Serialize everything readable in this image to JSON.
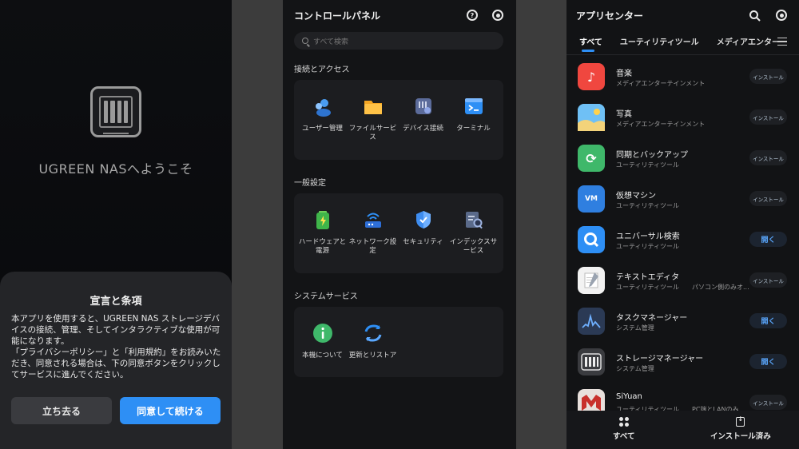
{
  "welcome_panel": {
    "welcome_text": "UGREEN NASへようこそ",
    "terms_title": "宣言と条項",
    "terms_paragraphs": [
      "本アプリを使用すると、UGREEN NAS ストレージデバイスの接続、管理、そしてインタラクティブな使用が可能になります。",
      "「プライバシーポリシー」と「利用規約」をお読みいただき、同意される場合は、下の同意ボタンをクリックしてサービスに進んでください。"
    ],
    "leave_button": "立ち去る",
    "agree_button": "同意して続ける"
  },
  "control_panel": {
    "title": "コントロールパネル",
    "help_icon_glyph": "?",
    "search_placeholder": "すべて検索",
    "sections": [
      {
        "title": "接続とアクセス",
        "items": [
          {
            "label": "ユーザー管理",
            "icon": "users-icon"
          },
          {
            "label": "ファイルサービス",
            "icon": "folder-icon"
          },
          {
            "label": "デバイス接続",
            "icon": "device-link-icon"
          },
          {
            "label": "ターミナル",
            "icon": "terminal-icon"
          }
        ]
      },
      {
        "title": "一般設定",
        "items": [
          {
            "label": "ハードウェアと電源",
            "icon": "battery-icon"
          },
          {
            "label": "ネットワーク設定",
            "icon": "router-icon"
          },
          {
            "label": "セキュリティ",
            "icon": "shield-icon"
          },
          {
            "label": "インデックスサービス",
            "icon": "index-search-icon"
          }
        ]
      },
      {
        "title": "システムサービス",
        "items": [
          {
            "label": "本機について",
            "icon": "info-icon"
          },
          {
            "label": "更新とリストア",
            "icon": "refresh-icon"
          }
        ]
      }
    ]
  },
  "app_center": {
    "title": "アプリセンター",
    "tabs": [
      "すべて",
      "ユーティリティツール",
      "メディアエンター"
    ],
    "apps": [
      {
        "name": "音楽",
        "category": "メディアエンターテインメント",
        "note": "",
        "button": "インストール",
        "open": false,
        "icon": "music-icon",
        "color": "#f0473f",
        "glyph": "♪"
      },
      {
        "name": "写真",
        "category": "メディアエンターテインメント",
        "note": "",
        "button": "インストール",
        "open": false,
        "icon": "photos-icon",
        "color": "#5ab0f0",
        "glyph": ""
      },
      {
        "name": "同期とバックアップ",
        "category": "ユーティリティツール",
        "note": "",
        "button": "インストール",
        "open": false,
        "icon": "sync-icon",
        "color": "#3fb86a",
        "glyph": "⟳"
      },
      {
        "name": "仮想マシン",
        "category": "ユーティリティツール",
        "note": "",
        "button": "インストール",
        "open": false,
        "icon": "vm-icon",
        "color": "#2f7fe0",
        "glyph": "VM"
      },
      {
        "name": "ユニバーサル検索",
        "category": "ユーティリティツール",
        "note": "",
        "button": "開く",
        "open": true,
        "icon": "universal-search-icon",
        "color": "#2e8ff5",
        "glyph": "Q"
      },
      {
        "name": "テキストエディタ",
        "category": "ユーティリティツール",
        "note": "パソコン側のみオ...",
        "button": "インストール",
        "open": false,
        "icon": "text-editor-icon",
        "color": "#f2f2f2",
        "glyph": ""
      },
      {
        "name": "タスクマネージャー",
        "category": "システム管理",
        "note": "",
        "button": "開く",
        "open": true,
        "icon": "task-manager-icon",
        "color": "#2b3a55",
        "glyph": ""
      },
      {
        "name": "ストレージマネージャー",
        "category": "システム管理",
        "note": "",
        "button": "開く",
        "open": true,
        "icon": "storage-manager-icon",
        "color": "#3a3b3f",
        "glyph": ""
      },
      {
        "name": "SiYuan",
        "category": "ユーティリティツール",
        "note": "PC端とLANのみ...",
        "button": "インストール",
        "open": false,
        "icon": "siyuan-icon",
        "color": "#e8e0dc",
        "glyph": ""
      }
    ],
    "bottom_nav": {
      "all": "すべて",
      "installed": "インストール済み"
    }
  }
}
